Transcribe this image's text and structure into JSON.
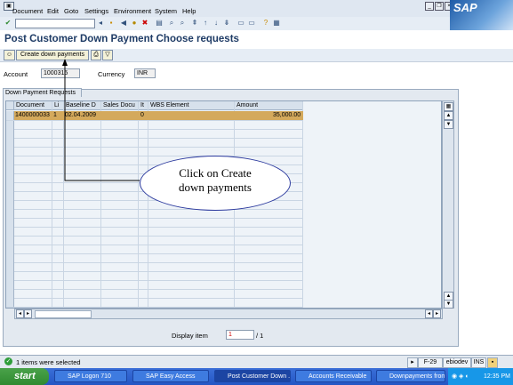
{
  "menu": {
    "items": [
      "Document",
      "Edit",
      "Goto",
      "Settings",
      "Environment",
      "System",
      "Help"
    ]
  },
  "brand": {
    "logo_text": "SAP"
  },
  "page": {
    "title": "Post Customer Down Payment Choose requests"
  },
  "app_toolbar": {
    "create_button": "Create down payments"
  },
  "header": {
    "account_label": "Account",
    "account_value": "1000315",
    "currency_label": "Currency",
    "currency_value": "INR"
  },
  "group": {
    "title": "Down Payment Requests"
  },
  "table": {
    "columns": [
      "Document",
      "Li",
      "Baseline D",
      "Sales Docu",
      "It",
      "WBS Element",
      "Amount"
    ],
    "rows": [
      {
        "document": "1400000033",
        "li": "1",
        "baseline": "02.04.2009",
        "sales": "",
        "it": "0",
        "wbs": "",
        "amount": "35,000.00"
      }
    ]
  },
  "display_item": {
    "label": "Display item",
    "value": "1",
    "total": "/ 1"
  },
  "status": {
    "message": "1 items were selected",
    "transaction": "F-29",
    "user": "ebiodev",
    "mode": "INS"
  },
  "callout": {
    "text_line1": "Click on Create",
    "text_line2": "down payments"
  },
  "taskbar": {
    "start": "start",
    "tasks": [
      "SAP Logon 710",
      "SAP Easy Access",
      "Post Customer Down ...",
      "Accounts Receivable",
      "Downpayments from ..."
    ],
    "clock": "12:35 PM"
  },
  "colors": {
    "selected_row": "#d4a95c",
    "callout_border": "#2c3a9e",
    "taskbar": "#2456c4"
  }
}
